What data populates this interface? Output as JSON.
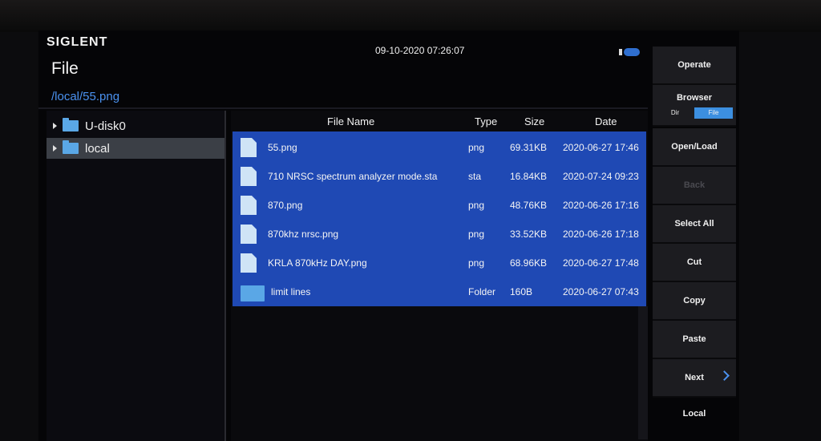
{
  "header": {
    "brand": "SIGLENT",
    "title": "File",
    "datetime": "09-10-2020 07:26:07",
    "path": "/local/55.png"
  },
  "tree": {
    "items": [
      {
        "label": "U-disk0",
        "selected": false
      },
      {
        "label": "local",
        "selected": true
      }
    ]
  },
  "file_list": {
    "columns": {
      "name": "File Name",
      "type": "Type",
      "size": "Size",
      "date": "Date"
    },
    "rows": [
      {
        "name": "55.png",
        "type": "png",
        "size": "69.31KB",
        "date": "2020-06-27 17:46",
        "icon": "file-icon"
      },
      {
        "name": "710 NRSC spectrum analyzer mode.sta",
        "type": "sta",
        "size": "16.84KB",
        "date": "2020-07-24 09:23",
        "icon": "file-icon"
      },
      {
        "name": "870.png",
        "type": "png",
        "size": "48.76KB",
        "date": "2020-06-26 17:16",
        "icon": "file-icon"
      },
      {
        "name": "870khz nrsc.png",
        "type": "png",
        "size": "33.52KB",
        "date": "2020-06-26 17:18",
        "icon": "file-icon"
      },
      {
        "name": "KRLA 870kHz DAY.png",
        "type": "png",
        "size": "68.96KB",
        "date": "2020-06-27 17:48",
        "icon": "file-icon"
      },
      {
        "name": "limit lines",
        "type": "Folder",
        "size": "160B",
        "date": "2020-06-27 07:43",
        "icon": "folder-icon"
      }
    ]
  },
  "menu": {
    "operate": "Operate",
    "browser": "Browser",
    "browser_dir": "Dir",
    "browser_file": "File",
    "open_load": "Open/Load",
    "back": "Back",
    "select_all": "Select All",
    "cut": "Cut",
    "copy": "Copy",
    "paste": "Paste",
    "next": "Next",
    "location": "Local"
  },
  "colors": {
    "accent": "#4b92f0",
    "selection": "#1f49b4",
    "folder": "#5aa7e6"
  }
}
